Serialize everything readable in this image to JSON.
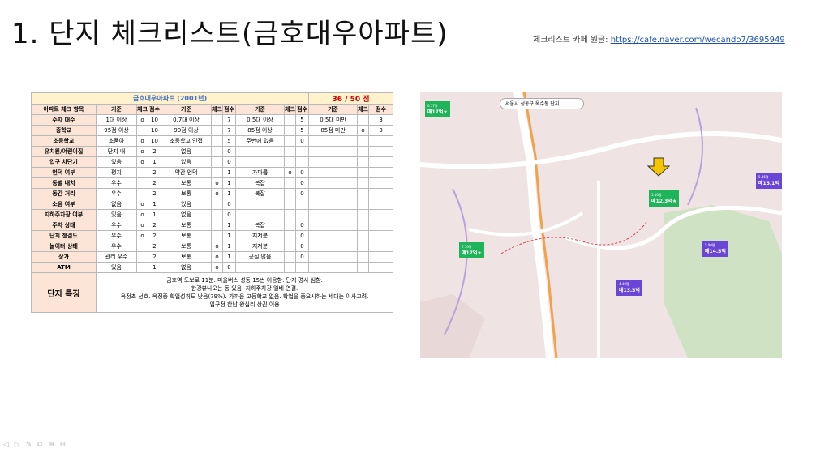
{
  "slide": {
    "title": "1. 단지 체크리스트(금호대우아파트)",
    "source_prefix": "체크리스트 카페 원글: ",
    "source_link": "https://cafe.naver.com/wecando7/3695949"
  },
  "table": {
    "title": "금호대우아파트 (2001년)",
    "score": "36 / 50 점",
    "headers": [
      "아파트 체크 항목",
      "기준",
      "체크",
      "점수",
      "기준",
      "체크",
      "점수",
      "기준",
      "체크",
      "점수",
      "기준",
      "체크",
      "점수"
    ],
    "rows": [
      [
        "주차 대수",
        "1대 이상",
        "o",
        "10",
        "0.7대 이상",
        "",
        "7",
        "0.5대 이상",
        "",
        "5",
        "0.5대 미만",
        "",
        "3"
      ],
      [
        "중학교",
        "95점 이상",
        "",
        "10",
        "90점 이상",
        "",
        "7",
        "85점 이상",
        "",
        "5",
        "85점 미만",
        "o",
        "3"
      ],
      [
        "초등학교",
        "초품아",
        "o",
        "10",
        "초등학교 인접",
        "",
        "5",
        "주변에 없음",
        "",
        "0",
        "",
        "",
        ""
      ],
      [
        "유치원/어린이집",
        "단지 내",
        "o",
        "2",
        "없음",
        "",
        "0",
        "",
        "",
        "",
        "",
        "",
        ""
      ],
      [
        "입구 차단기",
        "있음",
        "o",
        "1",
        "없음",
        "",
        "0",
        "",
        "",
        "",
        "",
        "",
        ""
      ],
      [
        "언덕 여부",
        "평지",
        "",
        "2",
        "약간 언덕",
        "",
        "1",
        "가파름",
        "o",
        "0",
        "",
        "",
        ""
      ],
      [
        "동별 배치",
        "우수",
        "",
        "2",
        "보통",
        "o",
        "1",
        "복잡",
        "",
        "0",
        "",
        "",
        ""
      ],
      [
        "동간 거리",
        "우수",
        "",
        "2",
        "보통",
        "o",
        "1",
        "복잡",
        "",
        "0",
        "",
        "",
        ""
      ],
      [
        "소음 여부",
        "없음",
        "o",
        "1",
        "있음",
        "",
        "0",
        "",
        "",
        "",
        "",
        "",
        ""
      ],
      [
        "지하주차장 여부",
        "있음",
        "o",
        "1",
        "없음",
        "",
        "0",
        "",
        "",
        "",
        "",
        "",
        ""
      ],
      [
        "주차 상태",
        "우수",
        "o",
        "2",
        "보통",
        "",
        "1",
        "복잡",
        "",
        "0",
        "",
        "",
        ""
      ],
      [
        "단지 청결도",
        "우수",
        "o",
        "2",
        "보통",
        "",
        "1",
        "지저분",
        "",
        "0",
        "",
        "",
        ""
      ],
      [
        "놀이터 상태",
        "우수",
        "",
        "2",
        "보통",
        "o",
        "1",
        "지저분",
        "",
        "0",
        "",
        "",
        ""
      ],
      [
        "상가",
        "관리 우수",
        "",
        "2",
        "보통",
        "o",
        "1",
        "공실 많음",
        "",
        "0",
        "",
        "",
        ""
      ],
      [
        "ATM",
        "있음",
        "",
        "1",
        "없음",
        "o",
        "0",
        "",
        "",
        "",
        "",
        "",
        ""
      ]
    ],
    "feature_label": "단지 특징",
    "feature_lines": [
      "금호역 도보로 11분. 마을버스 성동 15번 이용함. 단지 경사 심함.",
      "한강뷰나오는 동 있음. 지하주차장 엘베 연결.",
      "옥정초 선호. 옥정중 학업성취도 낮음(79%). 가까운 고등학교 없음. 학업을 중요시하는 세대는 이사고려.",
      "입구정 한남 왕십리 상권 이용"
    ]
  },
  "map": {
    "search_text": "서울시  성동구  옥수동  단지",
    "pins": [
      {
        "name": "pin-1",
        "label": "매17억★",
        "sub": "6.17평",
        "kind": "g"
      },
      {
        "name": "pin-2",
        "label": "매12.3억★",
        "sub": "5.10평",
        "kind": "g"
      },
      {
        "name": "pin-3",
        "label": "매15.1억",
        "sub": "5.46평",
        "kind": "p"
      },
      {
        "name": "pin-4",
        "label": "매17억★",
        "sub": "7.10평",
        "kind": "g"
      },
      {
        "name": "pin-5",
        "label": "매14.5억",
        "sub": "5.90평",
        "kind": "p"
      },
      {
        "name": "pin-6",
        "label": "매13.5억",
        "sub": "4.40평",
        "kind": "p"
      }
    ],
    "colors": {
      "land": "#efe3e3",
      "park": "#cfe3c4",
      "road": "#ffffff",
      "highway": "#f0a14a",
      "arrow": "#f2c500",
      "boundary": "#d24a4a"
    }
  },
  "toolbar": {
    "icons": "◁ ▷ ✎ ⧉ ⊕ ⊖"
  }
}
